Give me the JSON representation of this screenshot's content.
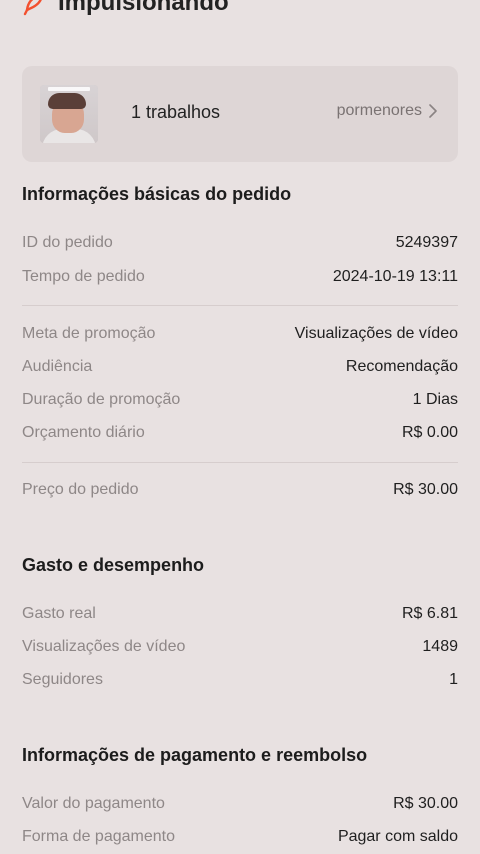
{
  "header": {
    "status_title": "Impulsionando",
    "icon": "boost-icon"
  },
  "work_card": {
    "count_label": "1 trabalhos",
    "details_label": "pormenores"
  },
  "basic_info": {
    "title": "Informações básicas do pedido",
    "order_id_label": "ID do pedido",
    "order_id_value": "5249397",
    "order_time_label": "Tempo de pedido",
    "order_time_value": "2024-10-19 13:11",
    "goal_label": "Meta de promoção",
    "goal_value": "Visualizações de vídeo",
    "audience_label": "Audiência",
    "audience_value": "Recomendação",
    "duration_label": "Duração de promoção",
    "duration_value": "1 Dias",
    "budget_label": "Orçamento diário",
    "budget_value": "R$ 0.00",
    "price_label": "Preço do pedido",
    "price_value": "R$ 30.00"
  },
  "performance": {
    "title": "Gasto e desempenho",
    "spent_label": "Gasto real",
    "spent_value": "R$ 6.81",
    "views_label": "Visualizações de vídeo",
    "views_value": "1489",
    "followers_label": "Seguidores",
    "followers_value": "1"
  },
  "payment": {
    "title": "Informações de pagamento e reembolso",
    "amount_label": "Valor do pagamento",
    "amount_value": "R$ 30.00",
    "method_label": "Forma de pagamento",
    "method_value": "Pagar com saldo"
  },
  "colors": {
    "background": "#e8e1e1",
    "card": "#ded6d6",
    "accent": "#f2502f",
    "label": "#8e8787"
  }
}
